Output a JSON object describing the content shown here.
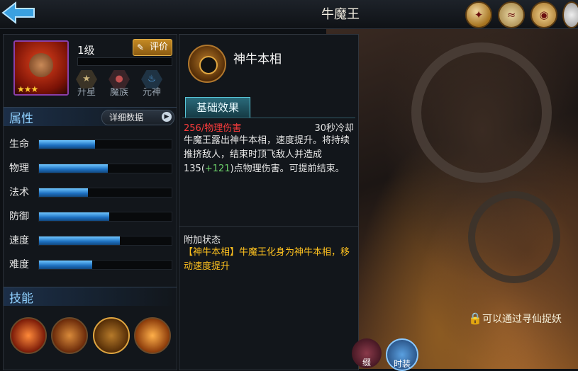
{
  "header": {
    "title": "牛魔王",
    "back_icon": "back-arrow-icon",
    "top_icons": [
      "compass-icon",
      "scroll-icon",
      "coin-icon",
      "mask-icon"
    ]
  },
  "hero": {
    "level": "1级",
    "stars": "★★★",
    "rate_label": "评价",
    "sub_buttons": [
      {
        "label": "升星",
        "icon": "star-upgrade-icon"
      },
      {
        "label": "魔族",
        "icon": "demon-icon"
      },
      {
        "label": "元神",
        "icon": "spirit-icon"
      }
    ]
  },
  "attributes": {
    "title": "属性",
    "detail_label": "详细数据",
    "stats": [
      {
        "name": "生命",
        "value": 0.42
      },
      {
        "name": "物理",
        "value": 0.52
      },
      {
        "name": "法术",
        "value": 0.37
      },
      {
        "name": "防御",
        "value": 0.53
      },
      {
        "name": "速度",
        "value": 0.61
      },
      {
        "name": "难度",
        "value": 0.4
      }
    ]
  },
  "skills": {
    "title": "技能",
    "items": [
      "skill-1-icon",
      "skill-2-icon",
      "skill-3-icon",
      "skill-4-icon"
    ]
  },
  "skill_detail": {
    "name": "神牛本相",
    "tab": "基础效果",
    "damage": "256/物理伤害",
    "cooldown": "30秒冷却",
    "desc_a": "牛魔王露出神牛本相，速度提升。将持续推挤敌人，结束时顶飞敌人并造成135(",
    "desc_bonus": "+121",
    "desc_b": ")点物理伤害。可提前结束。",
    "extra_title": "附加状态",
    "extra_desc": "【神牛本相】牛魔王化身为神牛本相，移动速度提升"
  },
  "footer": {
    "lock_note": "可以通过寻仙捉妖",
    "bottom_buttons": [
      "缀",
      "时装"
    ]
  }
}
